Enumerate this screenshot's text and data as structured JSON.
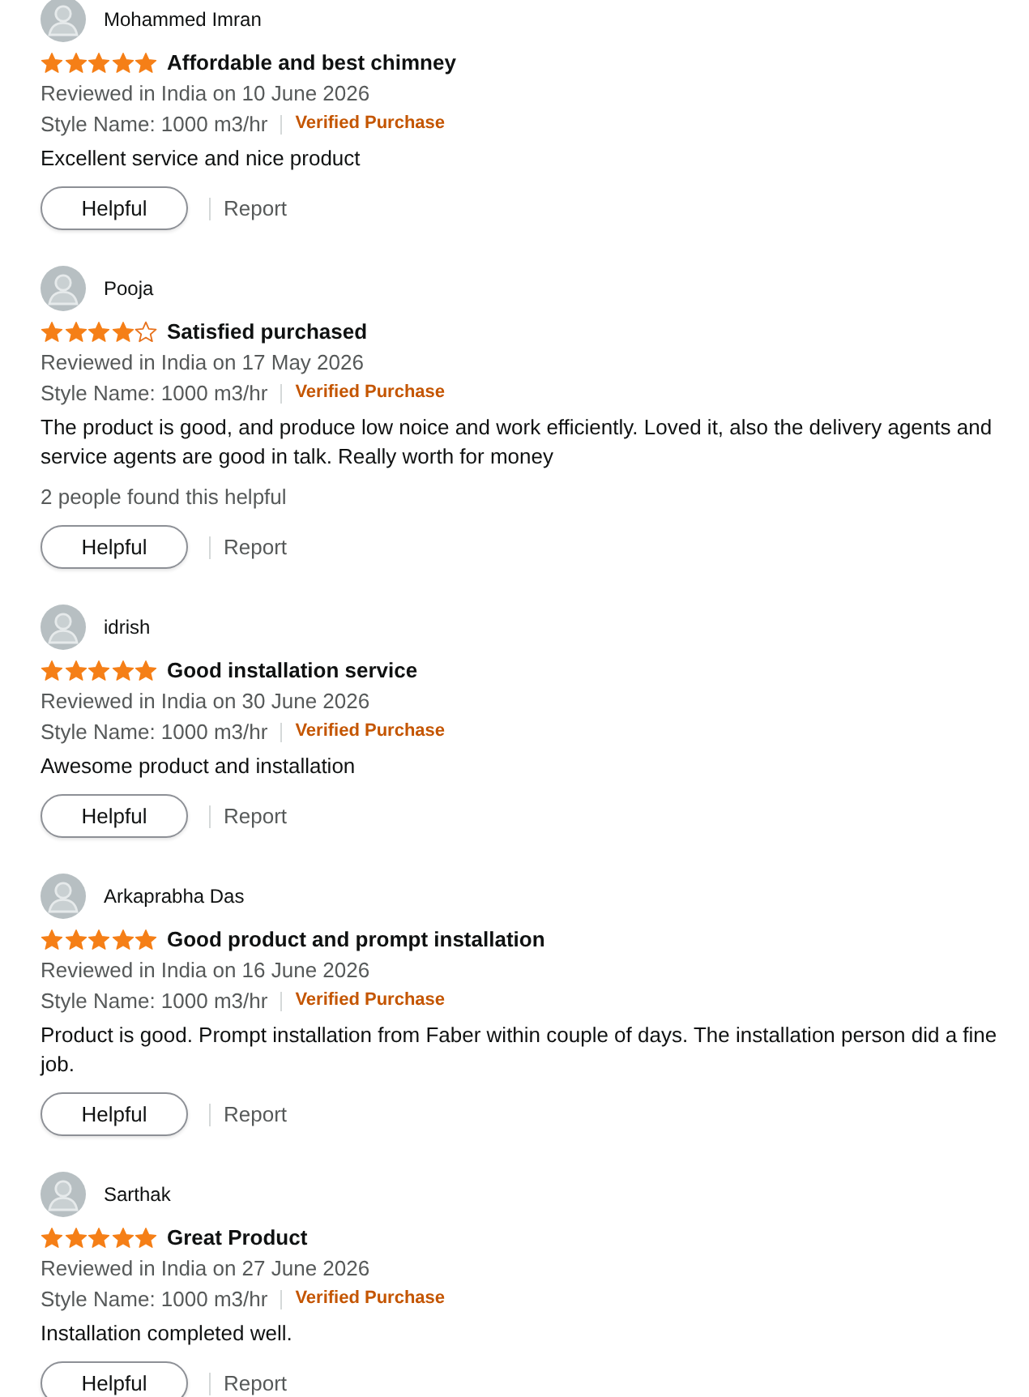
{
  "reviews": [
    {
      "reviewer": "Mohammed Imran",
      "stars": 5,
      "title": "Affordable and best chimney",
      "date": "Reviewed in India on 10 June 2026",
      "style": "Style Name: 1000 m3/hr",
      "badge": "Verified Purchase",
      "body": "Excellent service and nice product",
      "helpful_button": "Helpful",
      "report_link": "Report"
    },
    {
      "reviewer": "Pooja",
      "stars": 4,
      "title": "Satisfied purchased",
      "date": "Reviewed in India on 17 May 2026",
      "style": "Style Name: 1000 m3/hr",
      "badge": "Verified Purchase",
      "body": "The product is good, and produce low noice and work efficiently. Loved it, also the delivery agents and service agents are good in talk. Really worth for money",
      "helpful_count": "2 people found this helpful",
      "helpful_button": "Helpful",
      "report_link": "Report"
    },
    {
      "reviewer": "idrish",
      "stars": 5,
      "title": "Good installation service",
      "date": "Reviewed in India on 30 June 2026",
      "style": "Style Name: 1000 m3/hr",
      "badge": "Verified Purchase",
      "body": "Awesome product and installation",
      "helpful_button": "Helpful",
      "report_link": "Report"
    },
    {
      "reviewer": "Arkaprabha Das",
      "stars": 5,
      "title": "Good product and prompt installation",
      "date": "Reviewed in India on 16 June 2026",
      "style": "Style Name: 1000 m3/hr",
      "badge": "Verified Purchase",
      "body": "Product is good. Prompt installation from Faber within couple of days. The installation person did a fine job.",
      "helpful_button": "Helpful",
      "report_link": "Report"
    },
    {
      "reviewer": "Sarthak",
      "stars": 5,
      "title": "Great Product",
      "date": "Reviewed in India on 27 June 2026",
      "style": "Style Name: 1000 m3/hr",
      "badge": "Verified Purchase",
      "body": "Installation completed well.",
      "helpful_button": "Helpful",
      "report_link": "Report"
    }
  ]
}
